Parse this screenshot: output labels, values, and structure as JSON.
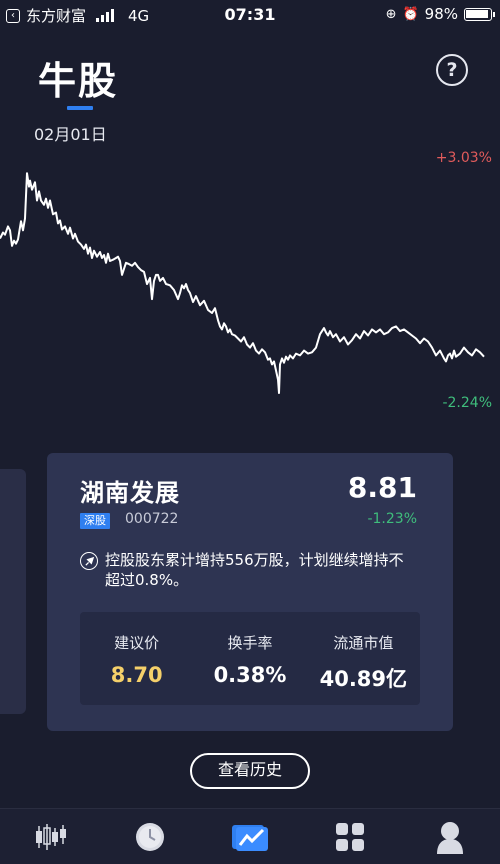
{
  "status_bar": {
    "carrier": "东方财富",
    "network": "4G",
    "time": "07:31",
    "battery": "98%"
  },
  "header": {
    "title": "牛股",
    "date": "02月01日",
    "help_icon": "question-mark-icon"
  },
  "chart_data": {
    "type": "line",
    "y_max_label": "+3.03%",
    "y_min_label": "-2.24%",
    "ylim": [
      -2.24,
      3.03
    ],
    "x": [
      0,
      3,
      5,
      8,
      10,
      12,
      14,
      16,
      18,
      21,
      23,
      25,
      27,
      29,
      30,
      32,
      35,
      37,
      39,
      41,
      44,
      46,
      48,
      50,
      53,
      56,
      58,
      60,
      62,
      65,
      68,
      70,
      73,
      75,
      78,
      81,
      84,
      86,
      88,
      90,
      92,
      94,
      97,
      100,
      102,
      104,
      106,
      108,
      110,
      113,
      116,
      118,
      120,
      122,
      124,
      126,
      129,
      132,
      135,
      138,
      141,
      144,
      147,
      150,
      152,
      154,
      156,
      158,
      160,
      163,
      166,
      170,
      174,
      178,
      180,
      182,
      184,
      186,
      188,
      190,
      193,
      196,
      200,
      204,
      208,
      212,
      215,
      218,
      220,
      222,
      224,
      226,
      228,
      230,
      232,
      235,
      238,
      241,
      244,
      247,
      250,
      253,
      256,
      259,
      262,
      265,
      268,
      270,
      272,
      274,
      276,
      278,
      279,
      280,
      282,
      284,
      286,
      288,
      290,
      293,
      296,
      300,
      304,
      308,
      312,
      316,
      320,
      324,
      326,
      328,
      330,
      333,
      336,
      340,
      344,
      348,
      352,
      356,
      360,
      364,
      368,
      372,
      376,
      380,
      384,
      388,
      392,
      396,
      400,
      404,
      408,
      412,
      416,
      420,
      424,
      428,
      432,
      436,
      440,
      444,
      446,
      448,
      450,
      452,
      454,
      456,
      460,
      464,
      468,
      472,
      476,
      480,
      484,
      488,
      492,
      496,
      500
    ],
    "values": [
      1.33,
      1.47,
      1.42,
      1.61,
      1.52,
      1.16,
      1.28,
      1.21,
      1.31,
      1.73,
      1.52,
      1.79,
      2.84,
      2.53,
      2.67,
      2.46,
      2.63,
      2.21,
      2.42,
      2.21,
      2.11,
      2.25,
      2.04,
      2.21,
      1.89,
      1.93,
      1.68,
      1.75,
      1.54,
      1.61,
      1.44,
      1.58,
      1.33,
      1.44,
      1.26,
      1.19,
      1.09,
      1.19,
      0.98,
      1.12,
      0.88,
      1.05,
      0.91,
      1.02,
      0.88,
      0.95,
      0.77,
      0.98,
      0.81,
      0.84,
      0.88,
      0.91,
      0.81,
      0.49,
      0.63,
      0.77,
      0.74,
      0.7,
      0.77,
      0.67,
      0.6,
      0.56,
      0.28,
      0.42,
      -0.07,
      0.35,
      0.49,
      0.49,
      0.35,
      0.42,
      0.28,
      0.25,
      0.14,
      -0.07,
      0.07,
      0.25,
      0.18,
      0.28,
      0.14,
      0.07,
      -0.14,
      0.0,
      -0.21,
      -0.11,
      -0.32,
      -0.39,
      -0.28,
      -0.56,
      -0.7,
      -0.77,
      -0.63,
      -0.7,
      -0.84,
      -0.77,
      -0.88,
      -0.91,
      -0.98,
      -1.05,
      -0.95,
      -1.12,
      -1.19,
      -1.09,
      -1.26,
      -1.33,
      -1.23,
      -1.3,
      -1.47,
      -1.44,
      -1.58,
      -1.51,
      -1.72,
      -1.93,
      -2.24,
      -1.58,
      -1.44,
      -1.54,
      -1.4,
      -1.47,
      -1.37,
      -1.44,
      -1.33,
      -1.37,
      -1.26,
      -1.33,
      -1.3,
      -1.19,
      -0.88,
      -0.74,
      -0.84,
      -0.91,
      -0.81,
      -0.95,
      -0.88,
      -1.05,
      -0.95,
      -1.12,
      -1.02,
      -0.88,
      -0.98,
      -0.81,
      -0.91,
      -0.77,
      -0.84,
      -0.77,
      -0.88,
      -0.84,
      -0.74,
      -0.7,
      -0.81,
      -0.77,
      -0.84,
      -0.91,
      -0.98,
      -1.09,
      -0.98,
      -1.05,
      -1.19,
      -1.37,
      -1.26,
      -1.44,
      -1.51,
      -1.37,
      -1.33,
      -1.44,
      -1.26,
      -1.4,
      -1.33,
      -1.19,
      -1.3,
      -1.37,
      -1.23,
      -1.3,
      -1.4
    ]
  },
  "card": {
    "stock_name": "湖南发展",
    "price": "8.81",
    "market": "深股",
    "code": "000722",
    "change": "-1.23%",
    "news_icon": "rocket-icon",
    "news": "控股股东累计增持556万股，计划继续增持不超过0.8%。",
    "metrics": [
      {
        "label": "建议价",
        "value": "8.70"
      },
      {
        "label": "换手率",
        "value": "0.38%"
      },
      {
        "label": "流通市值",
        "value": "40.89亿"
      }
    ]
  },
  "history_button": "查看历史",
  "bottom_nav": [
    {
      "icon": "candlestick-icon"
    },
    {
      "icon": "clock-icon"
    },
    {
      "icon": "trend-chart-icon",
      "active": true
    },
    {
      "icon": "grid-icon"
    },
    {
      "icon": "user-icon"
    }
  ],
  "colors": {
    "background": "#1a1d2e",
    "accent": "#2f7ff0",
    "up": "#e05b5b",
    "down": "#3fbd7c",
    "gold": "#f5d06a"
  }
}
